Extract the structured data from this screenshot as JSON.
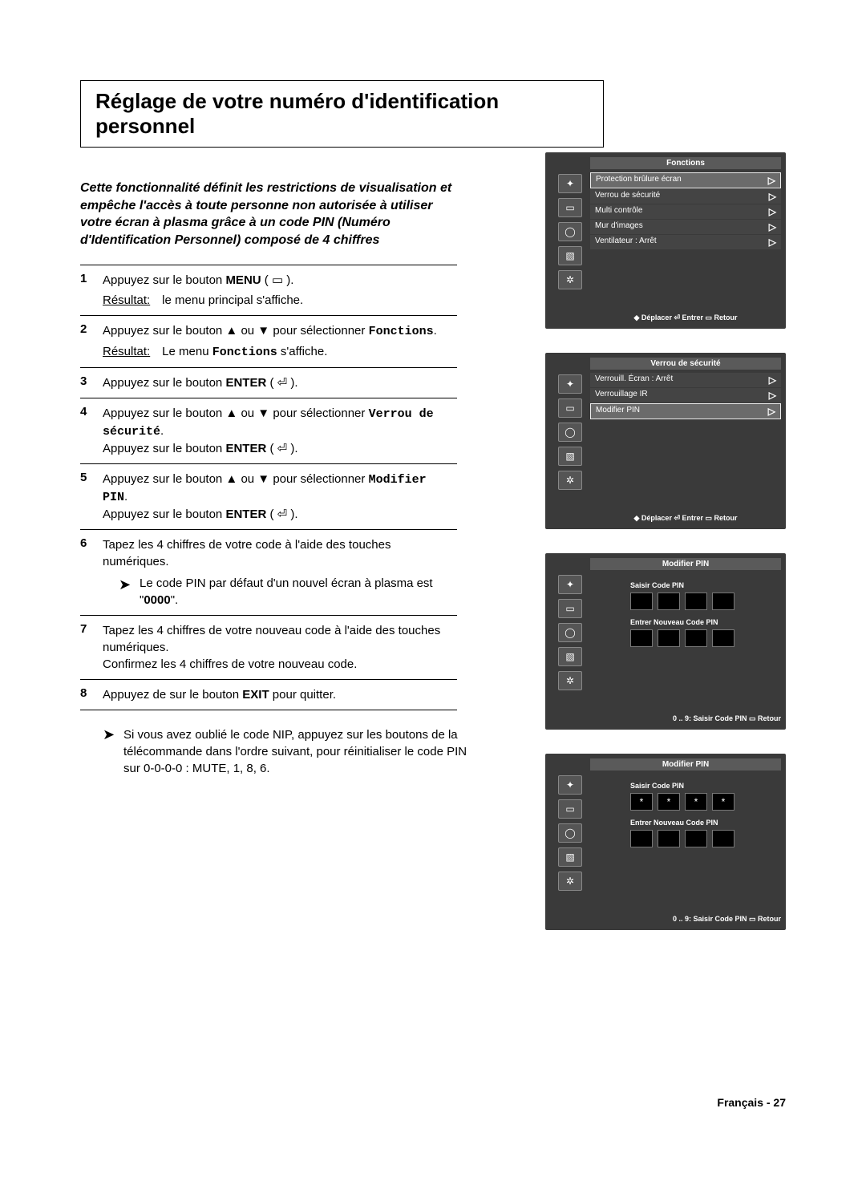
{
  "title": "Réglage de votre numéro d'identification personnel",
  "intro": "Cette fonctionnalité définit les restrictions de visualisation et empêche l'accès à toute personne non autorisée à utiliser votre écran à plasma grâce à un code PIN (Numéro d'Identification Personnel) composé de 4 chiffres",
  "steps": {
    "s1a": "Appuyez sur le bouton ",
    "s1b": "MENU",
    "s1c": " ( ▭ ).",
    "s1_res_lbl": "Résultat:",
    "s1_res": "le menu principal s'affiche.",
    "s2a": "Appuyez sur le bouton ▲ ou ▼ pour sélectionner ",
    "s2b": "Fonctions",
    "s2c": ".",
    "s2_res_lbl": "Résultat:",
    "s2_res_a": "Le menu ",
    "s2_res_b": "Fonctions",
    "s2_res_c": " s'affiche.",
    "s3a": "Appuyez sur le bouton ",
    "s3b": "ENTER",
    "s3c": " ( ⏎ ).",
    "s4a": "Appuyez sur le bouton ▲ ou ▼ pour sélectionner ",
    "s4b": "Verrou de sécurité",
    "s4c": ".",
    "s4d": "Appuyez sur le bouton ",
    "s4e": "ENTER",
    "s4f": " ( ⏎ ).",
    "s5a": "Appuyez sur le bouton ▲ ou ▼ pour sélectionner ",
    "s5b": "Modifier PIN",
    "s5c": ".",
    "s5d": "Appuyez sur le bouton ",
    "s5e": "ENTER",
    "s5f": " ( ⏎ ).",
    "s6a": "Tapez les 4 chiffres de votre code à l'aide des touches numériques.",
    "s6_note_a": "Le code PIN par défaut d'un nouvel écran à plasma est \"",
    "s6_note_b": "0000",
    "s6_note_c": "\".",
    "s7a": "Tapez les 4 chiffres de votre nouveau code à l'aide des touches numériques.",
    "s7b": "Confirmez les 4 chiffres de votre nouveau code.",
    "s8a": "Appuyez de sur le bouton ",
    "s8b": "EXIT",
    "s8c": " pour quitter."
  },
  "after_note": "Si vous avez oublié le code NIP, appuyez sur les boutons de la télécommande dans l'ordre suivant, pour réinitialiser le code PIN sur 0-0-0-0 : MUTE, 1, 8, 6.",
  "osd1": {
    "title": "Fonctions",
    "items": [
      {
        "label": "Protection brûlure écran",
        "hl": true
      },
      {
        "label": "Verrou de sécurité"
      },
      {
        "label": "Multi contrôle"
      },
      {
        "label": "Mur d'images"
      },
      {
        "label": "Ventilateur        : Arrêt"
      }
    ],
    "footer": "◆ Déplacer  ⏎ Entrer  ▭ Retour"
  },
  "osd2": {
    "title": "Verrou de sécurité",
    "items": [
      {
        "label": "Verrouill. Écran : Arrêt"
      },
      {
        "label": "Verrouillage IR"
      },
      {
        "label": "Modifier PIN",
        "hl": true
      }
    ],
    "footer": "◆ Déplacer  ⏎ Entrer  ▭ Retour"
  },
  "osd3": {
    "title": "Modifier PIN",
    "saisir": "Saisir Code PIN",
    "nouveau": "Entrer Nouveau Code PIN",
    "pin1": [
      "",
      "",
      "",
      ""
    ],
    "pin2": [
      "",
      "",
      "",
      ""
    ],
    "footer": "0 .. 9: Saisir Code PIN  ▭ Retour"
  },
  "osd4": {
    "title": "Modifier PIN",
    "saisir": "Saisir Code PIN",
    "nouveau": "Entrer Nouveau Code PIN",
    "pin1": [
      "*",
      "*",
      "*",
      "*"
    ],
    "pin2": [
      "",
      "",
      "",
      ""
    ],
    "footer": "0 .. 9: Saisir Code PIN  ▭ Retour"
  },
  "page_footer": "Français - 27",
  "nums": {
    "n1": "1",
    "n2": "2",
    "n3": "3",
    "n4": "4",
    "n5": "5",
    "n6": "6",
    "n7": "7",
    "n8": "8"
  },
  "arrow_glyph": "➤"
}
